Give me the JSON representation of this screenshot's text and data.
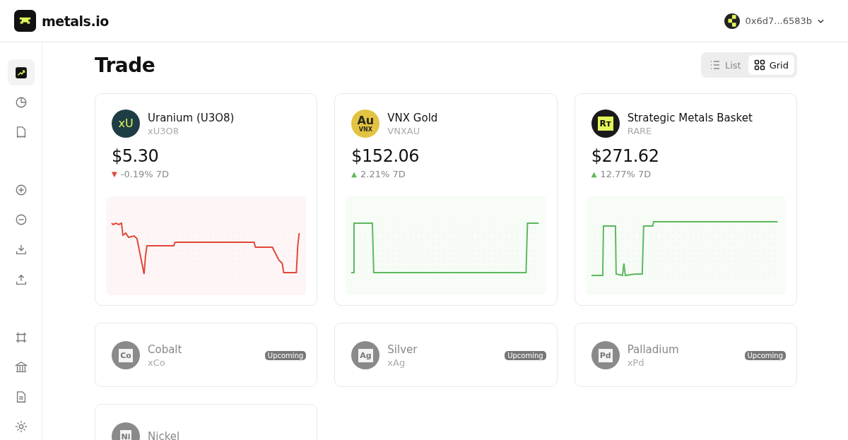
{
  "brand": {
    "name": "metals.io"
  },
  "wallet": {
    "address": "0x6d7...6583b"
  },
  "sidebar": {
    "items": [
      {
        "kind": "trend",
        "selected": true
      },
      {
        "kind": "pie",
        "selected": false
      },
      {
        "kind": "receipt",
        "selected": false
      },
      {
        "kind": "plus",
        "selected": false
      },
      {
        "kind": "minus",
        "selected": false
      },
      {
        "kind": "download",
        "selected": false
      },
      {
        "kind": "upload",
        "selected": false
      },
      {
        "kind": "frame",
        "selected": false
      },
      {
        "kind": "bank",
        "selected": false
      },
      {
        "kind": "document",
        "selected": false
      },
      {
        "kind": "gear",
        "selected": false
      }
    ]
  },
  "page": {
    "title": "Trade"
  },
  "view_toggle": [
    {
      "label": "List",
      "kind": "list",
      "selected": false
    },
    {
      "label": "Grid",
      "kind": "grid",
      "selected": true
    }
  ],
  "assets": [
    {
      "name": "Uranium (U3O8)",
      "symbol": "xU3O8",
      "kind": "uranium",
      "logo_text": "xU",
      "price": "$5.30",
      "arrow": "▼",
      "change": "-0.19% 7D",
      "color": "#e0483a"
    },
    {
      "name": "VNX Gold",
      "symbol": "VNXAU",
      "kind": "gold",
      "logo_text": "Au",
      "logo_subtext": "VNX",
      "price": "$152.06",
      "arrow": "▲",
      "change": "2.21% 7D",
      "color": "#5cb85c"
    },
    {
      "name": "Strategic Metals Basket",
      "symbol": "RARE",
      "kind": "basket",
      "logo_text": "Rт",
      "price": "$271.62",
      "arrow": "▲",
      "change": "12.77% 7D",
      "color": "#5cb85c"
    }
  ],
  "upcoming": [
    {
      "name": "Cobalt",
      "symbol": "xCo",
      "logo_text": "Co",
      "badge": "Upcoming"
    },
    {
      "name": "Silver",
      "symbol": "xAg",
      "logo_text": "Ag",
      "badge": "Upcoming"
    },
    {
      "name": "Palladium",
      "symbol": "xPd",
      "logo_text": "Pd",
      "badge": "Upcoming"
    },
    {
      "name": "Nickel",
      "logo_text": "Ni"
    }
  ]
}
